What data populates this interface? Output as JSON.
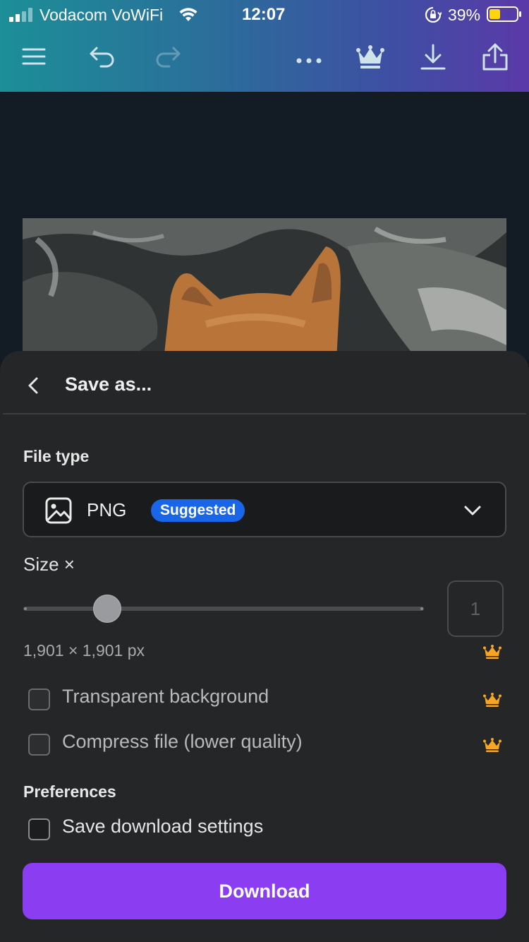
{
  "status_bar": {
    "carrier": "Vodacom VoWiFi",
    "time": "12:07",
    "battery_percent": "39%",
    "battery_color": "#ffd60a"
  },
  "toolbar": {
    "icons": [
      "menu-icon",
      "undo-icon",
      "redo-icon",
      "more-icon",
      "crown-icon",
      "download-icon",
      "share-icon"
    ],
    "gradient": [
      "#1c8f98",
      "#5b39a8"
    ]
  },
  "sheet": {
    "title": "Save as...",
    "file_type": {
      "label": "File type",
      "value": "PNG",
      "badge": "Suggested",
      "badge_color": "#1a66e8"
    },
    "size": {
      "label": "Size ×",
      "multiplier": "1",
      "slider_level": 0.21,
      "dimensions": "1,901 × 1,901 px"
    },
    "options": [
      {
        "label": "Transparent background",
        "checked": false,
        "premium": true
      },
      {
        "label": "Compress file (lower quality)",
        "checked": false,
        "premium": true
      }
    ],
    "preferences": {
      "label": "Preferences",
      "save_settings_label": "Save download settings",
      "checked": false
    },
    "download_label": "Download",
    "download_color": "#8b3df2",
    "premium_color": "#f6a623"
  }
}
